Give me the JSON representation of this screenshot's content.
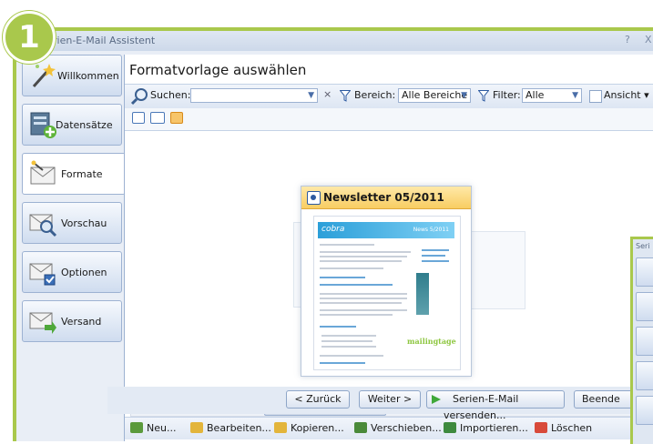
{
  "badge": "1",
  "window": {
    "title": "Serien-E-Mail Assistent",
    "title_visible": "rien-E-Mail Assistent",
    "help": "?",
    "close": "X"
  },
  "nav": [
    {
      "label": "Willkommen",
      "icon": "magic-wand-icon"
    },
    {
      "label": "Datensätze",
      "icon": "database-add-icon"
    },
    {
      "label": "Formate",
      "icon": "envelope-format-icon",
      "active": true
    },
    {
      "label": "Vorschau",
      "icon": "envelope-preview-icon"
    },
    {
      "label": "Optionen",
      "icon": "envelope-options-icon"
    },
    {
      "label": "Versand",
      "icon": "envelope-send-icon"
    }
  ],
  "page_title": "Formatvorlage auswählen",
  "search": {
    "label": "Suchen:",
    "value": "",
    "clear": "×",
    "bereich_label": "Bereich:",
    "bereich_value": "Alle Bereiche",
    "filter_label": "Filter:",
    "filter_value": "Alle",
    "ansicht_label": "Ansicht"
  },
  "preview": {
    "card_title": "Newsletter 05/2011",
    "thumb_logo": "cobra",
    "thumb_issue": "News 5/2011",
    "thumb_brand": "mailingtage"
  },
  "scroll_label": "III",
  "actions": [
    {
      "label": "Neu...",
      "color": "#5b9a3c"
    },
    {
      "label": "Bearbeiten...",
      "color": "#e3b53b"
    },
    {
      "label": "Kopieren...",
      "color": "#e3b53b"
    },
    {
      "label": "Verschieben...",
      "color": "#4a8a3a"
    },
    {
      "label": "Importieren...",
      "color": "#3e8a3e"
    },
    {
      "label": "Löschen",
      "color": "#d84a3a"
    }
  ],
  "footer": {
    "back": "< Zurück",
    "next": "Weiter >",
    "send": "Serien-E-Mail versenden...",
    "finish": "Beende"
  },
  "overlay_title": "Seri",
  "colors": {
    "accent": "#a9c84c",
    "nav_border": "#9db2d2",
    "card_header": "#f8cd62"
  }
}
